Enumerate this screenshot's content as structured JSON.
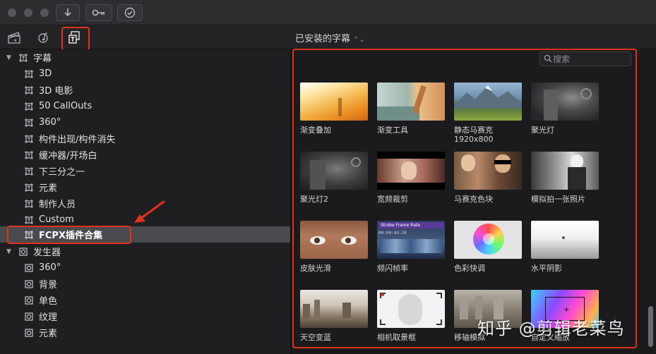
{
  "toolbar": {
    "buttons": [
      {
        "name": "import-button",
        "icon": "download-arrow-icon"
      },
      {
        "name": "keywords-button",
        "icon": "key-icon"
      },
      {
        "name": "background-tasks-button",
        "icon": "checkmark-circle-icon"
      }
    ]
  },
  "library_tabs": [
    {
      "name": "tab-media",
      "icon": "clapper-icon"
    },
    {
      "name": "tab-audio",
      "icon": "music-icon"
    },
    {
      "name": "tab-titles",
      "icon": "titles-icon",
      "selected": true
    }
  ],
  "browser": {
    "title": "已安装的字幕",
    "chevron": "⌃⌄",
    "search_placeholder": "搜索"
  },
  "sidebar": {
    "groups": [
      {
        "label": "字幕",
        "expanded": true,
        "items": [
          "3D",
          "3D 电影",
          "50 CallOuts",
          "360°",
          "构件出现/构件消失",
          "缓冲器/开场白",
          "下三分之一",
          "元素",
          "制作人员",
          "Custom",
          "FCPX插件合集"
        ],
        "selected_index": 10
      },
      {
        "label": "发生器",
        "expanded": true,
        "items": [
          "360°",
          "背景",
          "单色",
          "纹理",
          "元素"
        ]
      }
    ]
  },
  "thumbs": [
    {
      "label": "渐变叠加"
    },
    {
      "label": "渐变工具"
    },
    {
      "label": "静态马赛克",
      "label2": "1920x800"
    },
    {
      "label": "聚光灯"
    },
    {
      "label": "聚光灯2"
    },
    {
      "label": "宽频裁剪"
    },
    {
      "label": "马赛克色块"
    },
    {
      "label": "模拟拍一张照片"
    },
    {
      "label": "皮肤光滑"
    },
    {
      "label": "频闪帧率",
      "overlay_title": "Strobe Frame Rate",
      "overlay_time": "00:00:43:20"
    },
    {
      "label": "色彩快调"
    },
    {
      "label": "水平阴影"
    },
    {
      "label": "天空变蓝"
    },
    {
      "label": "相机取景框"
    },
    {
      "label": "移轴模拟"
    },
    {
      "label": "自定义缩放"
    }
  ],
  "watermark": "知乎 @剪辑老菜鸟",
  "colors": {
    "highlight_red": "#e0321e",
    "selection": "#4a4a4e"
  }
}
